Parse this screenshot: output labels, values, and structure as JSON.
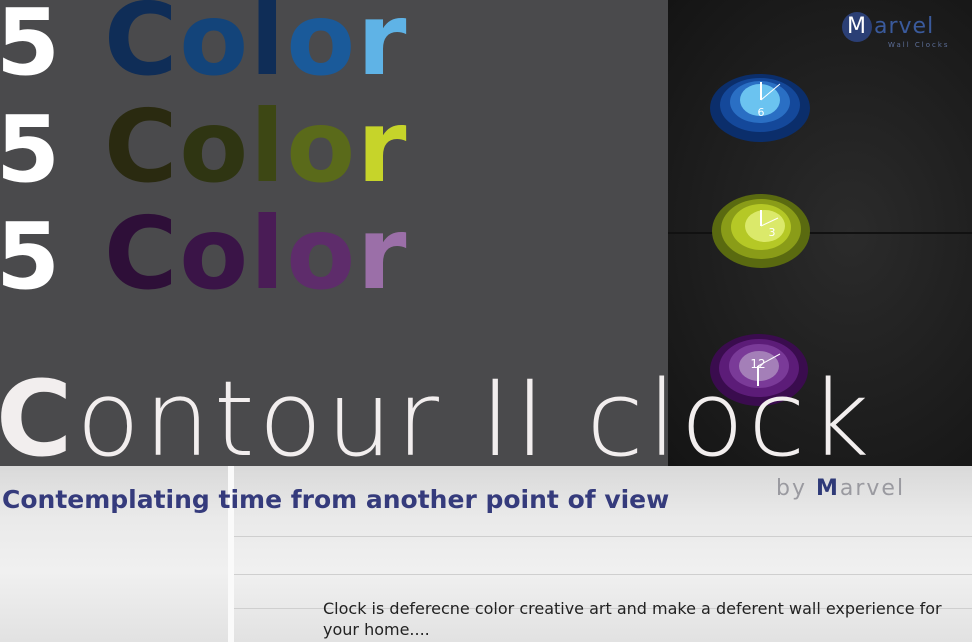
{
  "rows": [
    {
      "number": "5",
      "letters": [
        "C",
        "o",
        "l",
        "o",
        "r"
      ],
      "colors": [
        "#0f2d57",
        "#13447a",
        "#0f2d57",
        "#1a5a9a",
        "#5fb3e6"
      ]
    },
    {
      "number": "5",
      "letters": [
        "C",
        "o",
        "l",
        "o",
        "r"
      ],
      "colors": [
        "#2a2a10",
        "#2f3512",
        "#3d4714",
        "#5a6a1a",
        "#c6d42a"
      ]
    },
    {
      "number": "5",
      "letters": [
        "C",
        "o",
        "l",
        "o",
        "r"
      ],
      "colors": [
        "#2e0f38",
        "#3a1447",
        "#4a1c56",
        "#5e2c6b",
        "#9b6fa8"
      ]
    }
  ],
  "brand": {
    "logo_initial": "M",
    "logo_rest": "arvel",
    "logo_sub": "Wall Clocks"
  },
  "clocks": [
    {
      "numeral": "6",
      "colors": [
        "#0b2e6b",
        "#14489a",
        "#2a6fc4",
        "#6bc3f0"
      ]
    },
    {
      "numeral": "3",
      "colors": [
        "#5a6a10",
        "#8a9c18",
        "#b5c826",
        "#dbe96a"
      ]
    },
    {
      "numeral": "12",
      "colors": [
        "#3a0c4e",
        "#5c1c78",
        "#7a3a98",
        "#a47fb8"
      ]
    }
  ],
  "title": {
    "initial": "C",
    "rest": "ontour II clock"
  },
  "byline": {
    "prefix": "by ",
    "initial": "M",
    "rest": "arvel"
  },
  "tagline": "Contemplating time from another point of view",
  "description": "Clock is deferecne color creative art and make a deferent wall experience for your home...."
}
